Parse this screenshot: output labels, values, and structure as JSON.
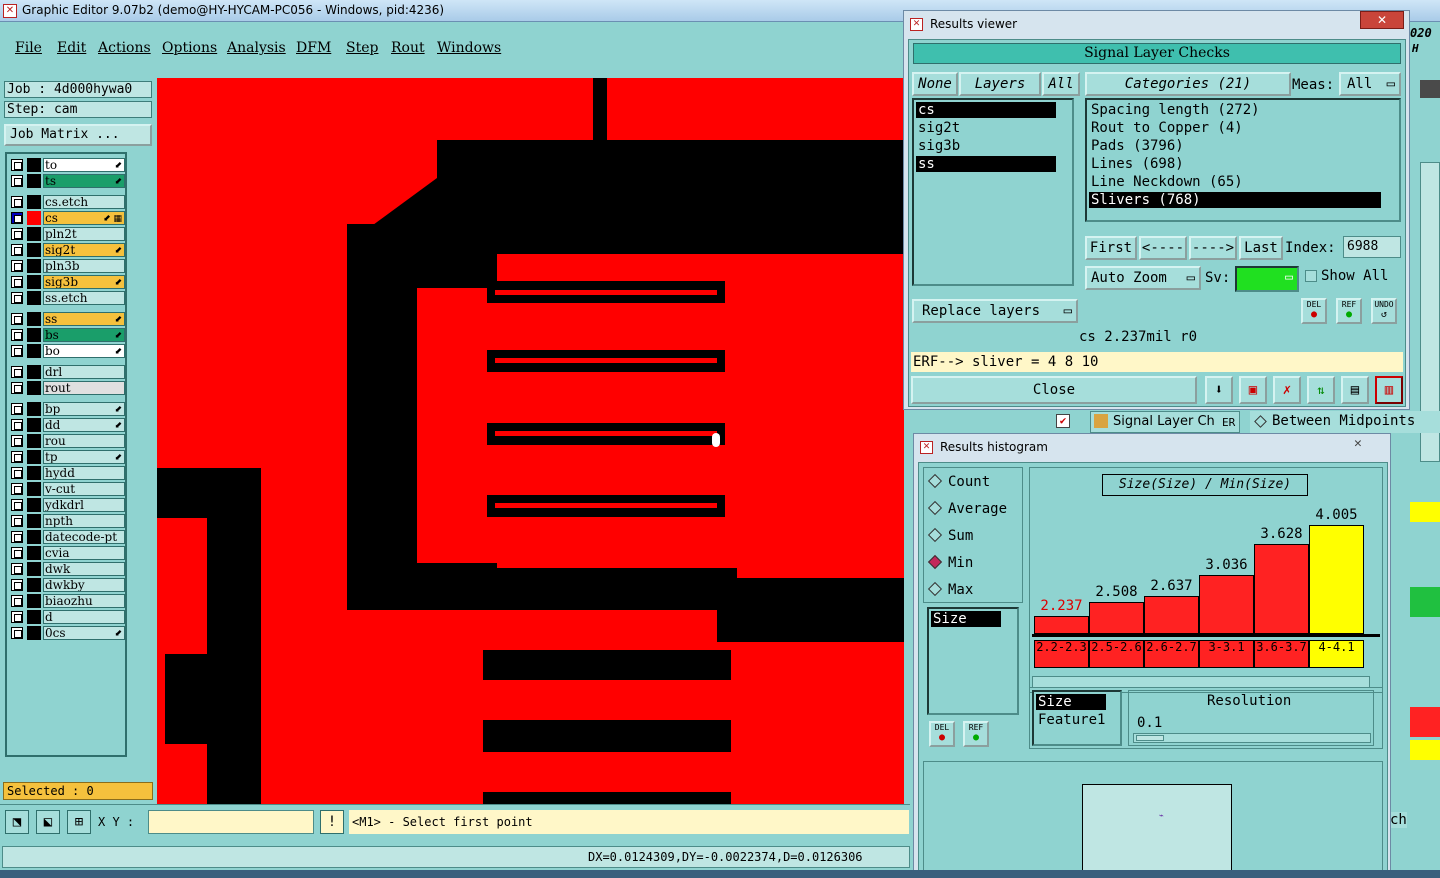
{
  "app": {
    "title": "Graphic Editor 9.07b2 (demo@HY-HYCAM-PC056 - Windows, pid:4236)",
    "icon": "app-x-icon"
  },
  "menu": [
    "File",
    "Edit",
    "Actions",
    "Options",
    "Analysis",
    "DFM",
    "Step",
    "Rout",
    "Windows"
  ],
  "job": {
    "job": "Job : 4d000hywa0",
    "step": "Step: cam",
    "matrix": "Job Matrix ..."
  },
  "layers": [
    {
      "name": "to",
      "color": "#ffffff",
      "flag": "⬋"
    },
    {
      "name": "ts",
      "color": "#1a9e6a",
      "flag": "⬋"
    },
    {
      "name": "cs.etch",
      "color": "#bfe6e3",
      "flag": ""
    },
    {
      "name": "cs",
      "color": "#f5c13d",
      "flag": "⬋ ▦"
    },
    {
      "name": "pln2t",
      "color": "#bfe6e3",
      "flag": ""
    },
    {
      "name": "sig2t",
      "color": "#f5c13d",
      "flag": "⬋"
    },
    {
      "name": "pln3b",
      "color": "#bfe6e3",
      "flag": ""
    },
    {
      "name": "sig3b",
      "color": "#f5c13d",
      "flag": "⬋"
    },
    {
      "name": "ss.etch",
      "color": "#bfe6e3",
      "flag": ""
    },
    {
      "name": "ss",
      "color": "#f5c13d",
      "flag": "⬋"
    },
    {
      "name": "bs",
      "color": "#1a9e6a",
      "flag": "⬋"
    },
    {
      "name": "bo",
      "color": "#ffffff",
      "flag": "⬋"
    },
    {
      "name": "drl",
      "color": "#bfe6e3",
      "flag": ""
    },
    {
      "name": "rout",
      "color": "#e0e0e0",
      "flag": ""
    },
    {
      "name": "bp",
      "color": "#bfe6e3",
      "flag": "⬋"
    },
    {
      "name": "dd",
      "color": "#bfe6e3",
      "flag": "⬋"
    },
    {
      "name": "rou",
      "color": "#bfe6e3",
      "flag": ""
    },
    {
      "name": "tp",
      "color": "#bfe6e3",
      "flag": "⬋"
    },
    {
      "name": "hydd",
      "color": "#bfe6e3",
      "flag": ""
    },
    {
      "name": "v-cut",
      "color": "#bfe6e3",
      "flag": ""
    },
    {
      "name": "ydkdrl",
      "color": "#bfe6e3",
      "flag": ""
    },
    {
      "name": "npth",
      "color": "#bfe6e3",
      "flag": ""
    },
    {
      "name": "datecode-pt",
      "color": "#bfe6e3",
      "flag": ""
    },
    {
      "name": "cvia",
      "color": "#bfe6e3",
      "flag": ""
    },
    {
      "name": "dwk",
      "color": "#bfe6e3",
      "flag": ""
    },
    {
      "name": "dwkby",
      "color": "#bfe6e3",
      "flag": ""
    },
    {
      "name": "biaozhu",
      "color": "#bfe6e3",
      "flag": ""
    },
    {
      "name": "d",
      "color": "#bfe6e3",
      "flag": ""
    },
    {
      "name": "0cs",
      "color": "#bfe6e3",
      "flag": "⬋"
    }
  ],
  "selected": "Selected : 0",
  "status": {
    "xy_label": "X Y :",
    "prompt": "<M1> - Select first point",
    "measure": "DX=0.0124309,DY=-0.0022374,D=0.0126306"
  },
  "results_viewer": {
    "title": "Results viewer",
    "header": "Signal Layer Checks",
    "tabs": {
      "none": "None",
      "layers": "Layers",
      "all": "All",
      "categories": "Categories (21)",
      "meas_label": "Meas:",
      "meas_value": "All"
    },
    "layer_list": [
      {
        "name": "cs",
        "selected": true
      },
      {
        "name": "sig2t",
        "selected": false
      },
      {
        "name": "sig3b",
        "selected": false
      },
      {
        "name": "ss",
        "selected": true
      }
    ],
    "categories": [
      {
        "name": "Spacing length (272)",
        "selected": false
      },
      {
        "name": "Rout to Copper (4)",
        "selected": false
      },
      {
        "name": "Pads (3796)",
        "selected": false
      },
      {
        "name": "Lines (698)",
        "selected": false
      },
      {
        "name": "Line Neckdown (65)",
        "selected": false
      },
      {
        "name": "Slivers (768)",
        "selected": true
      }
    ],
    "nav": {
      "first": "First",
      "prev": "<----",
      "next": "---->",
      "last": "Last",
      "index_label": "Index:",
      "index_value": "6988"
    },
    "auto_zoom": "Auto Zoom",
    "sv_label": "Sv:",
    "show_all": "Show All",
    "replace_layers": "Replace layers",
    "detail": "cs 2.237mil  r0",
    "erf": "ERF--> sliver = 4 8 10",
    "close": "Close",
    "del": "DEL",
    "ref": "REF",
    "undo": "UNDO"
  },
  "histogram": {
    "title": "Results histogram",
    "modes": [
      {
        "name": "Count",
        "on": false
      },
      {
        "name": "Average",
        "on": false
      },
      {
        "name": "Sum",
        "on": false
      },
      {
        "name": "Min",
        "on": true
      },
      {
        "name": "Max",
        "on": false
      }
    ],
    "chart_title": "Size(Size) / Min(Size)",
    "attr": "Size",
    "bins": [
      {
        "label": "2.2-2.3",
        "value": "2.237"
      },
      {
        "label": "2.5-2.6",
        "value": "2.508"
      },
      {
        "label": "2.6-2.7",
        "value": "2.637"
      },
      {
        "label": "3-3.1",
        "value": "3.036"
      },
      {
        "label": "3.6-3.7",
        "value": "3.628"
      },
      {
        "label": "4-4.1",
        "value": "4.005"
      }
    ],
    "fields": [
      "Size",
      "Feature1"
    ],
    "resolution_label": "Resolution",
    "resolution_value": "0.1",
    "del": "DEL",
    "ref": "REF"
  },
  "bg_fragments": {
    "signal_tab": "Signal Layer Ch",
    "er": "ER",
    "between": "Between Midpoints",
    "year": "020",
    "h": "H",
    "ch": "ch"
  },
  "chart_data": {
    "type": "bar",
    "title": "Size(Size) / Min(Size)",
    "categories": [
      "2.2-2.3",
      "2.5-2.6",
      "2.6-2.7",
      "3-3.1",
      "3.6-3.7",
      "4-4.1"
    ],
    "values": [
      2.237,
      2.508,
      2.637,
      3.036,
      3.628,
      4.005
    ],
    "colors": [
      "#ff2222",
      "#ff2222",
      "#ff2222",
      "#ff2222",
      "#ff2222",
      "#ffff00"
    ]
  }
}
